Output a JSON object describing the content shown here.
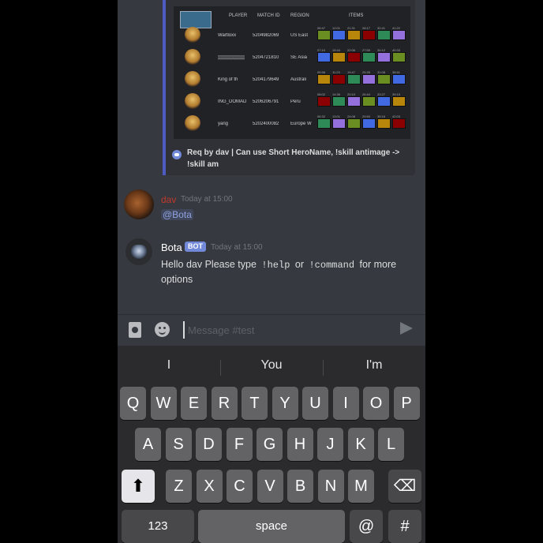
{
  "embed": {
    "headers": [
      "PLAYER",
      "MATCH ID",
      "REGION",
      "ITEMS"
    ],
    "matches": [
      {
        "player": "Wartloxx",
        "match_id": "5204982069",
        "region": "US East",
        "times": [
          "06:47",
          "12:01",
          "21:31",
          "28:17",
          "32:41",
          "41:22"
        ]
      },
      {
        "player": "▒▒▒▒▒▒▒▒",
        "match_id": "5204721810",
        "region": "SE Asia",
        "times": [
          "07:10",
          "15:44",
          "22:06",
          "27:59",
          "34:12",
          "40:33"
        ]
      },
      {
        "player": "King of th",
        "match_id": "5204179649",
        "region": "Australi",
        "times": [
          "05:58",
          "11:23",
          "19:47",
          "25:35",
          "31:08",
          "38:51"
        ]
      },
      {
        "player": "ING_DOMAD",
        "match_id": "5206206791",
        "region": "Peru",
        "times": [
          "08:02",
          "14:36",
          "20:19",
          "26:44",
          "33:27",
          "39:15"
        ]
      },
      {
        "player": "yang",
        "match_id": "5202400082",
        "region": "Europe W",
        "times": [
          "06:32",
          "13:01",
          "24:08",
          "29:50",
          "35:16",
          "42:03"
        ]
      }
    ],
    "footer": "Req by dav | Can use Short HeroName, !skill antimage -> !skill am",
    "item_colors": [
      "#6b8e23",
      "#4169e1",
      "#b8860b",
      "#8b0000",
      "#2e8b57",
      "#9370db"
    ]
  },
  "messages": {
    "dav": {
      "name": "dav",
      "timestamp": "Today at 15:00",
      "mention": "@Bota"
    },
    "bota": {
      "name": "Bota",
      "badge": "BOT",
      "timestamp": "Today at 15:00",
      "text_before": "Hello dav Please type ",
      "cmd1": "!help",
      "middle": " or ",
      "cmd2": "!command",
      "text_after": " for more options"
    }
  },
  "input": {
    "placeholder": "Message #test"
  },
  "keyboard": {
    "suggestions": [
      "I",
      "You",
      "I'm"
    ],
    "row1": [
      "Q",
      "W",
      "E",
      "R",
      "T",
      "Y",
      "U",
      "I",
      "O",
      "P"
    ],
    "row2": [
      "A",
      "S",
      "D",
      "F",
      "G",
      "H",
      "J",
      "K",
      "L"
    ],
    "row3": [
      "Z",
      "X",
      "C",
      "V",
      "B",
      "N",
      "M"
    ],
    "shift": "⬆",
    "backspace": "⌫",
    "numbers": "123",
    "space": "space",
    "at": "@",
    "hash": "#"
  }
}
